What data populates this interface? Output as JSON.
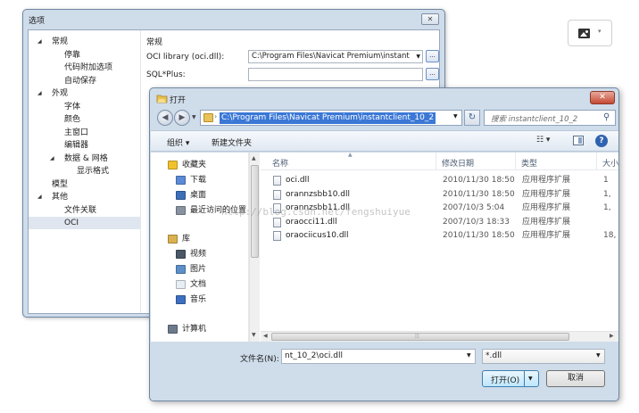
{
  "options_window": {
    "title": "选项",
    "close_label": "✕",
    "tree": [
      {
        "label": "常规",
        "level": 0,
        "expanded": true
      },
      {
        "label": "停靠",
        "level": 1
      },
      {
        "label": "代码附加选项",
        "level": 1
      },
      {
        "label": "自动保存",
        "level": 1
      },
      {
        "label": "外观",
        "level": 0,
        "expanded": true
      },
      {
        "label": "字体",
        "level": 1
      },
      {
        "label": "颜色",
        "level": 1
      },
      {
        "label": "主窗口",
        "level": 1
      },
      {
        "label": "编辑器",
        "level": 1
      },
      {
        "label": "数据 & 网格",
        "level": 1,
        "expanded": true
      },
      {
        "label": "显示格式",
        "level": 2
      },
      {
        "label": "模型",
        "level": 0
      },
      {
        "label": "其他",
        "level": 0,
        "expanded": true
      },
      {
        "label": "文件关联",
        "level": 1
      },
      {
        "label": "OCI",
        "level": 1,
        "selected": true
      }
    ],
    "section_title": "常规",
    "oci_library": {
      "label": "OCI library (oci.dll):",
      "value": "C:\\Program Files\\Navicat Premium\\instant",
      "browse_label": "..."
    },
    "sqlplus": {
      "label": "SQL*Plus:",
      "value": "",
      "browse_label": "..."
    }
  },
  "image_widget": {
    "icon": "image-icon",
    "caret": "▾"
  },
  "open_dialog": {
    "title": "打开",
    "close_label": "✕",
    "address": "C:\\Program Files\\Navicat Premium\\instantclient_10_2",
    "search_placeholder": "搜索 instantclient_10_2",
    "toolbar": {
      "organize": "组织 ▾",
      "new_folder": "新建文件夹",
      "view": "☷ ▾",
      "help": "?"
    },
    "nav_pane": [
      {
        "label": "收藏夹",
        "icon": "star-icon",
        "indent": 0
      },
      {
        "label": "下载",
        "icon": "download-folder-icon",
        "indent": 1
      },
      {
        "label": "桌面",
        "icon": "desktop-icon",
        "indent": 1
      },
      {
        "label": "最近访问的位置",
        "icon": "recent-places-icon",
        "indent": 1
      },
      {
        "label": "库",
        "icon": "library-icon",
        "indent": 0
      },
      {
        "label": "视频",
        "icon": "video-icon",
        "indent": 1
      },
      {
        "label": "图片",
        "icon": "pictures-icon",
        "indent": 1
      },
      {
        "label": "文档",
        "icon": "documents-icon",
        "indent": 1
      },
      {
        "label": "音乐",
        "icon": "music-icon",
        "indent": 1
      },
      {
        "label": "计算机",
        "icon": "computer-icon",
        "indent": 0
      }
    ],
    "columns": {
      "name": "名称",
      "date": "修改日期",
      "type": "类型",
      "size": "大小"
    },
    "files": [
      {
        "name": "oci.dll",
        "date": "2010/11/30 18:50",
        "type": "应用程序扩展",
        "size": "1"
      },
      {
        "name": "orannzsbb10.dll",
        "date": "2010/11/30 18:50",
        "type": "应用程序扩展",
        "size": "1,"
      },
      {
        "name": "orannzsbb11.dll",
        "date": "2007/10/3 5:04",
        "type": "应用程序扩展",
        "size": "1,"
      },
      {
        "name": "oraocci11.dll",
        "date": "2007/10/3 18:33",
        "type": "应用程序扩展",
        "size": ""
      },
      {
        "name": "oraociicus10.dll",
        "date": "2010/11/30 18:50",
        "type": "应用程序扩展",
        "size": "18,"
      }
    ],
    "filename_label": "文件名(N):",
    "filename_value": "nt_10_2\\oci.dll",
    "filetype_value": "*.dll",
    "open_button": "打开(O)",
    "cancel_button": "取消"
  },
  "watermark": "http://blog.csdn.net/fengshuiyue",
  "colors": {
    "address_highlight": "#3b78d6",
    "window_frame": "#cfdcea",
    "close_red": "#c44a34"
  }
}
